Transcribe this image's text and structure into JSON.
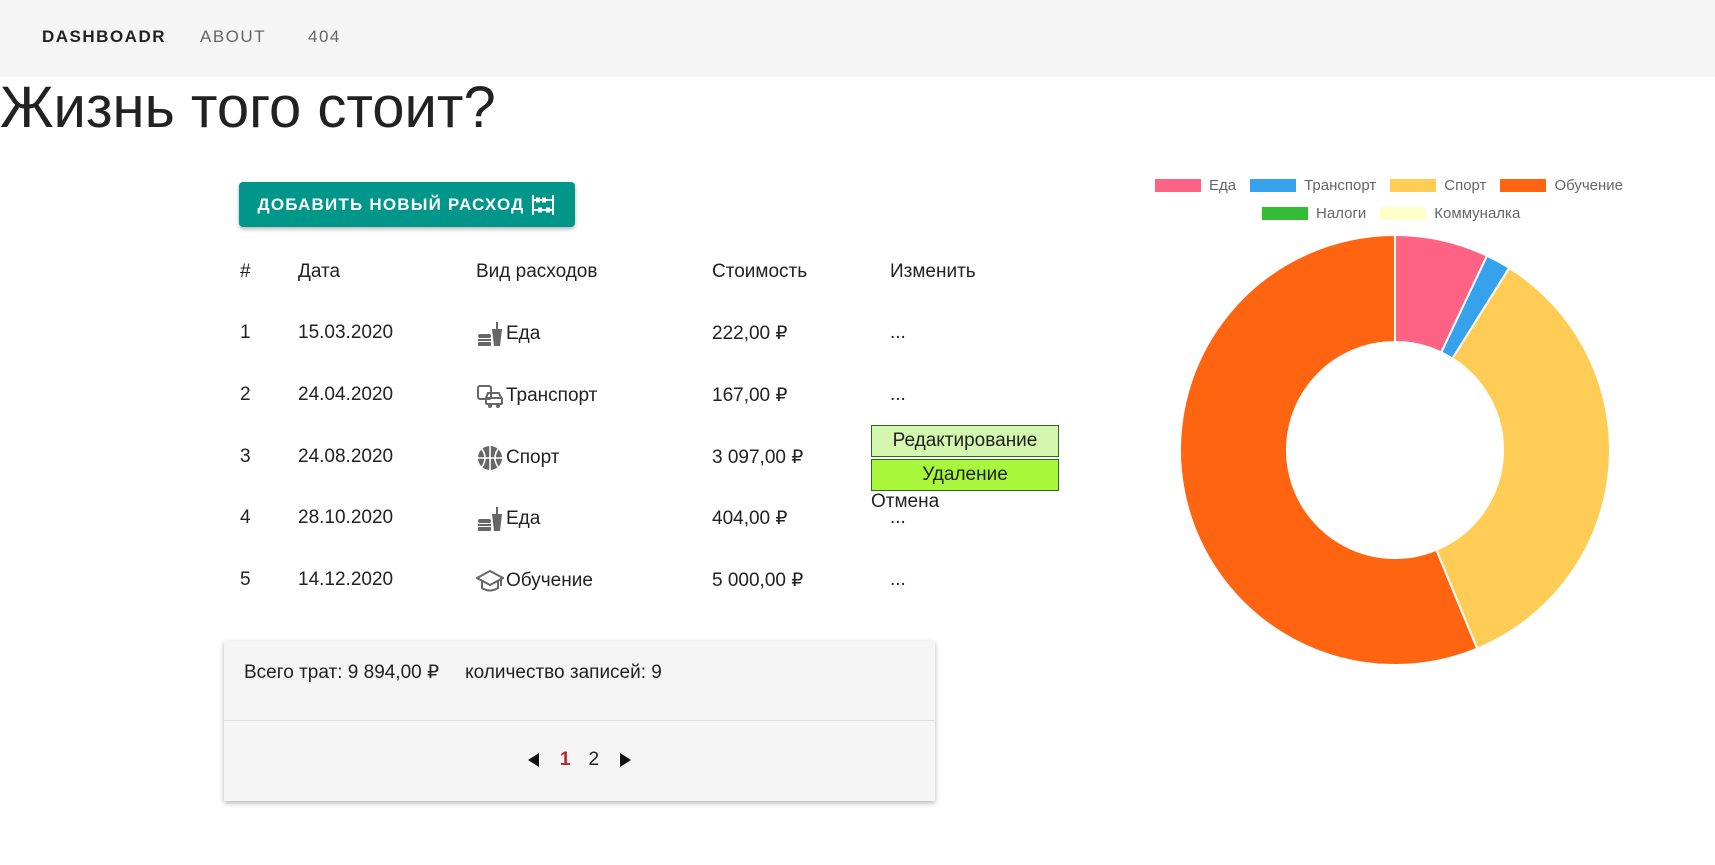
{
  "nav": {
    "items": [
      {
        "label": "DASHBOADR",
        "active": true
      },
      {
        "label": "ABOUT",
        "active": false
      },
      {
        "label": "404",
        "active": false
      }
    ]
  },
  "page": {
    "title": "Жизнь того стоит?"
  },
  "toolbar": {
    "add_label": "ДОБАВИТЬ НОВЫЙ РАСХОД",
    "add_icon": "abacus-icon"
  },
  "table": {
    "headers": [
      "#",
      "Дата",
      "Вид расходов",
      "Стоимость",
      "Изменить"
    ],
    "rows": [
      {
        "num": "1",
        "date": "15.03.2020",
        "icon": "fastfood-icon",
        "category": "Еда",
        "cost": "222,00 ₽",
        "edit": "..."
      },
      {
        "num": "2",
        "date": "24.04.2020",
        "icon": "commute-icon",
        "category": "Транспорт",
        "cost": "167,00 ₽",
        "edit": "..."
      },
      {
        "num": "3",
        "date": "24.08.2020",
        "icon": "basketball-icon",
        "category": "Спорт",
        "cost": "3 097,00 ₽",
        "edit": "..."
      },
      {
        "num": "4",
        "date": "28.10.2020",
        "icon": "fastfood-icon",
        "category": "Еда",
        "cost": "404,00 ₽",
        "edit": "..."
      },
      {
        "num": "5",
        "date": "14.12.2020",
        "icon": "school-icon",
        "category": "Обучение",
        "cost": "5 000,00 ₽",
        "edit": "..."
      }
    ]
  },
  "context_menu": {
    "edit_label": "Редактирование",
    "delete_label": "Удаление",
    "cancel_label": "Отмена"
  },
  "summary": {
    "total_label": "Всего трат: 9 894,00 ₽",
    "count_label": "количество записей: 9"
  },
  "pagination": {
    "pages": [
      "1",
      "2"
    ],
    "current": "1"
  },
  "chart_data": {
    "type": "pie",
    "donut": true,
    "legend_position": "top",
    "categories": [
      "Еда",
      "Транспорт",
      "Спорт",
      "Обучение",
      "Налоги",
      "Коммуналка"
    ],
    "values": [
      626,
      167,
      3097,
      5000,
      0,
      0
    ],
    "colors": [
      "#ff6384",
      "#36a2eb",
      "#ffcd56",
      "#ff6410",
      "#33bb33",
      "#ffffcc"
    ]
  }
}
